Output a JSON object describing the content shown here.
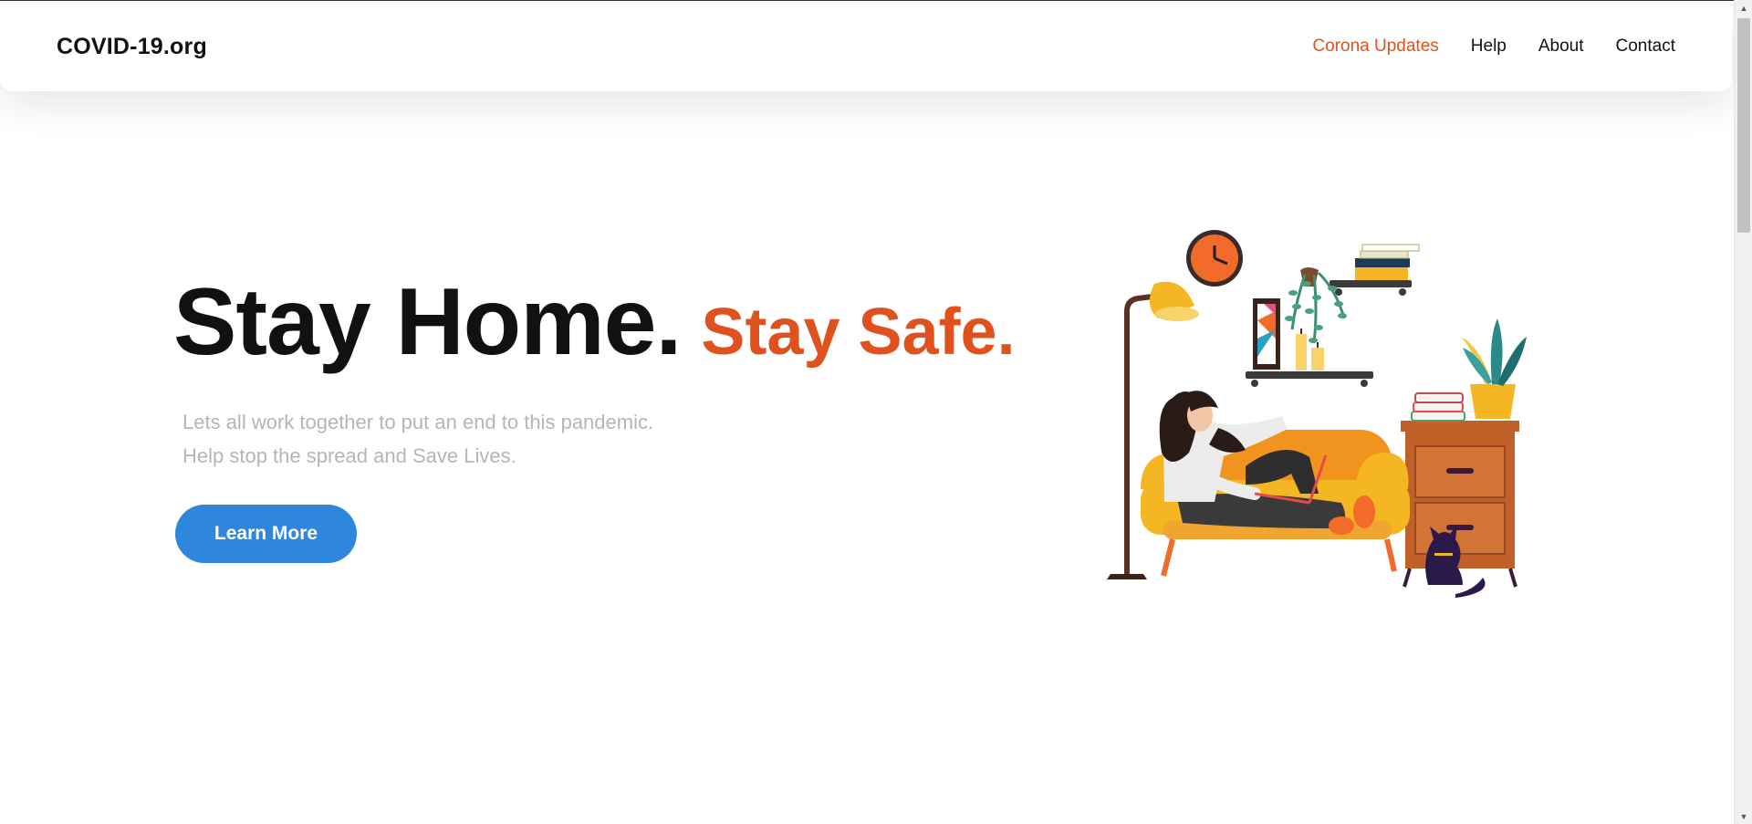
{
  "navbar": {
    "brand": "COVID-19.org",
    "links": [
      {
        "label": "Corona Updates",
        "active": true
      },
      {
        "label": "Help",
        "active": false
      },
      {
        "label": "About",
        "active": false
      },
      {
        "label": "Contact",
        "active": false
      }
    ]
  },
  "hero": {
    "title_main": "Stay Home.",
    "title_accent": "Stay Safe.",
    "subtitle_line1": "Lets all work together to put an end to this pandemic.",
    "subtitle_line2": "Help stop the spread and Save Lives.",
    "cta_label": "Learn More"
  },
  "colors": {
    "accent": "#e0521d",
    "button": "#2f87dd",
    "subtitle": "#b5b5b5",
    "text": "#111111"
  },
  "illustration": {
    "icons": [
      "woman-on-sofa",
      "floor-lamp-icon",
      "wall-clock-icon",
      "hanging-plant-icon",
      "books-icon",
      "picture-frame-icon",
      "candles-icon",
      "dresser-icon",
      "potted-plant-icon",
      "cat-icon",
      "laptop-icon"
    ]
  }
}
